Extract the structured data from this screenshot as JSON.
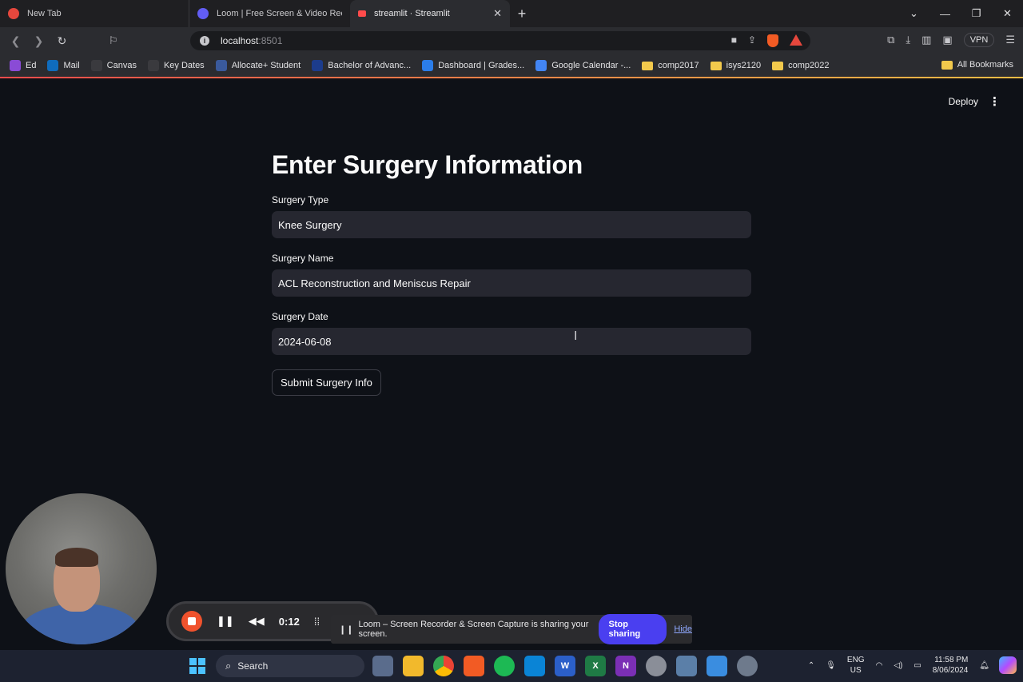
{
  "browser": {
    "tabs": [
      {
        "label": "New Tab",
        "color": "#e6473d"
      },
      {
        "label": "Loom | Free Screen & Video Recordi",
        "color": "#625df5"
      },
      {
        "label": "streamlit · Streamlit",
        "color": "#ff4b4b"
      }
    ],
    "new_tab_label": "+",
    "url_host": "localhost",
    "url_port": ":8501",
    "vpn_label": "VPN",
    "bookmarks": [
      {
        "label": "Ed",
        "color": "#8a4bd6"
      },
      {
        "label": "Mail",
        "color": "#0f6cbd"
      },
      {
        "label": "Canvas",
        "color": "#2b2c30"
      },
      {
        "label": "Key Dates",
        "color": "#2b2c30"
      },
      {
        "label": "Allocate+ Student",
        "color": "#2b2c30"
      },
      {
        "label": "Bachelor of Advanc...",
        "color": "#1c3c8c"
      },
      {
        "label": "Dashboard | Grades...",
        "color": "#2b7de9"
      },
      {
        "label": "Google Calendar -...",
        "color": "#4285f4"
      }
    ],
    "folders": [
      "comp2017",
      "isys2120",
      "comp2022"
    ],
    "all_bookmarks": "All Bookmarks"
  },
  "app": {
    "deploy_label": "Deploy",
    "title": "Enter Surgery Information",
    "fields": [
      {
        "label": "Surgery Type",
        "value": "Knee Surgery"
      },
      {
        "label": "Surgery Name",
        "value": "ACL Reconstruction and Meniscus Repair"
      },
      {
        "label": "Surgery Date",
        "value": "2024-06-08"
      }
    ],
    "submit_label": "Submit Surgery Info"
  },
  "loom": {
    "timer": "0:12",
    "share_message": "Loom – Screen Recorder & Screen Capture is sharing your screen.",
    "stop_label": "Stop sharing",
    "hide_label": "Hide"
  },
  "taskbar": {
    "search_label": "Search",
    "lang_line1": "ENG",
    "lang_line2": "US",
    "time": "11:58 PM",
    "date": "8/06/2024",
    "apps": [
      {
        "name": "notes",
        "color": "#5a6c8c"
      },
      {
        "name": "file-explorer",
        "color": "#f2b92c"
      },
      {
        "name": "chrome",
        "color": "#34a853"
      },
      {
        "name": "brave",
        "color": "#f25b24"
      },
      {
        "name": "spotify",
        "color": "#1db954"
      },
      {
        "name": "vscode",
        "color": "#0a84d6"
      },
      {
        "name": "word",
        "color": "#2b5fc9"
      },
      {
        "name": "excel",
        "color": "#1f7a45"
      },
      {
        "name": "onenote",
        "color": "#7b2fb5"
      },
      {
        "name": "app-gray",
        "color": "#8a8e98"
      },
      {
        "name": "photos",
        "color": "#5b7fa8"
      },
      {
        "name": "notepad",
        "color": "#3a8de0"
      },
      {
        "name": "settings",
        "color": "#6e7a8c"
      }
    ]
  }
}
